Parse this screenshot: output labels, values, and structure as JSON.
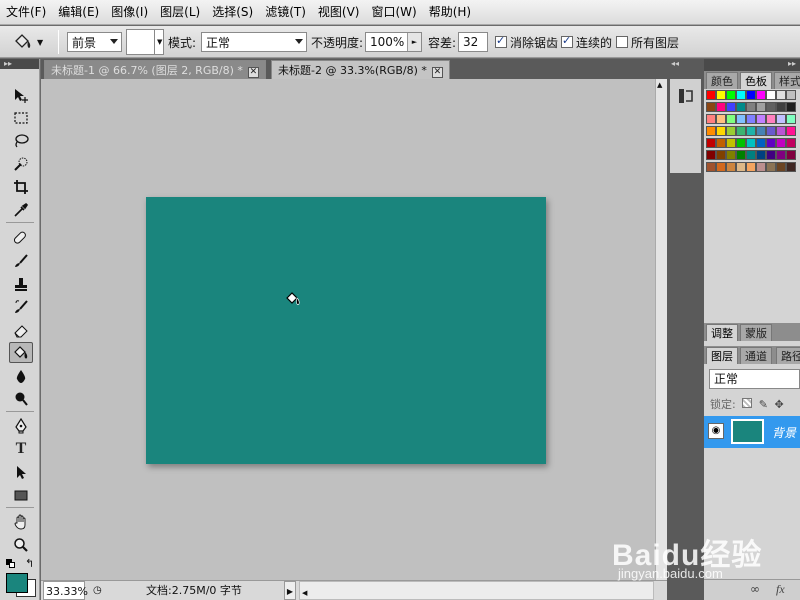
{
  "menu": [
    "文件(F)",
    "编辑(E)",
    "图像(I)",
    "图层(L)",
    "选择(S)",
    "滤镜(T)",
    "视图(V)",
    "窗口(W)",
    "帮助(H)"
  ],
  "options": {
    "fill_source": "前景",
    "mode_label": "模式:",
    "mode_value": "正常",
    "opacity_label": "不透明度:",
    "opacity_value": "100%",
    "tolerance_label": "容差:",
    "tolerance_value": "32",
    "antialias_label": "消除锯齿",
    "antialias_checked": true,
    "contiguous_label": "连续的",
    "contiguous_checked": true,
    "alllayers_label": "所有图层",
    "alllayers_checked": false
  },
  "tabs": [
    {
      "title": "未标题-1 @ 66.7% (图层 2, RGB/8) *",
      "active": false
    },
    {
      "title": "未标题-2 @ 33.3%(RGB/8) *",
      "active": true
    }
  ],
  "status": {
    "zoom": "33.33%",
    "doc_info": "文档:2.75M/0 字节"
  },
  "panels": {
    "color_tabs": [
      "颜色",
      "色板",
      "样式"
    ],
    "active_color_tab": "色板",
    "adjust_tabs": [
      "调整",
      "蒙版"
    ],
    "layer_tabs": [
      "图层",
      "通道",
      "路径"
    ],
    "blend_mode": "正常",
    "lock_label": "锁定:",
    "layer_name": "背景"
  },
  "colors": {
    "canvas": "#1a857d",
    "foreground": "#1a857d",
    "background": "#ffffff",
    "selection": "#3399ee"
  },
  "swatches": [
    [
      "#ff0000",
      "#ffff00",
      "#00ff00",
      "#00ffff",
      "#0000ff",
      "#ff00ff",
      "#ffffff",
      "#e0e0e0",
      "#c0c0c0"
    ],
    [
      "#8b4513",
      "#ff0080",
      "#4040ff",
      "#008b8b",
      "#808080",
      "#a0a0a0",
      "#606060",
      "#404040",
      "#202020"
    ],
    [
      "#ff8080",
      "#ffc080",
      "#80ff80",
      "#80c0ff",
      "#8080ff",
      "#c080ff",
      "#ff80c0",
      "#c0c0ff",
      "#80ffc0"
    ],
    [
      "#ff8c00",
      "#ffd700",
      "#9acd32",
      "#3cb371",
      "#20b2aa",
      "#4682b4",
      "#6a5acd",
      "#ba55d3",
      "#ff1493"
    ],
    [
      "#c00000",
      "#c06000",
      "#c0c000",
      "#00c000",
      "#00c0c0",
      "#0060c0",
      "#6000c0",
      "#c000c0",
      "#c00060"
    ],
    [
      "#800000",
      "#804000",
      "#808000",
      "#008000",
      "#008080",
      "#004080",
      "#400080",
      "#800080",
      "#800040"
    ],
    [
      "#a0522d",
      "#d2691e",
      "#cd853f",
      "#deb887",
      "#f4a460",
      "#bc8f8f",
      "#8b7355",
      "#6b4423",
      "#3e2723"
    ]
  ],
  "watermark": {
    "brand": "Baidu经验",
    "url": "jingyan.baidu.com"
  }
}
